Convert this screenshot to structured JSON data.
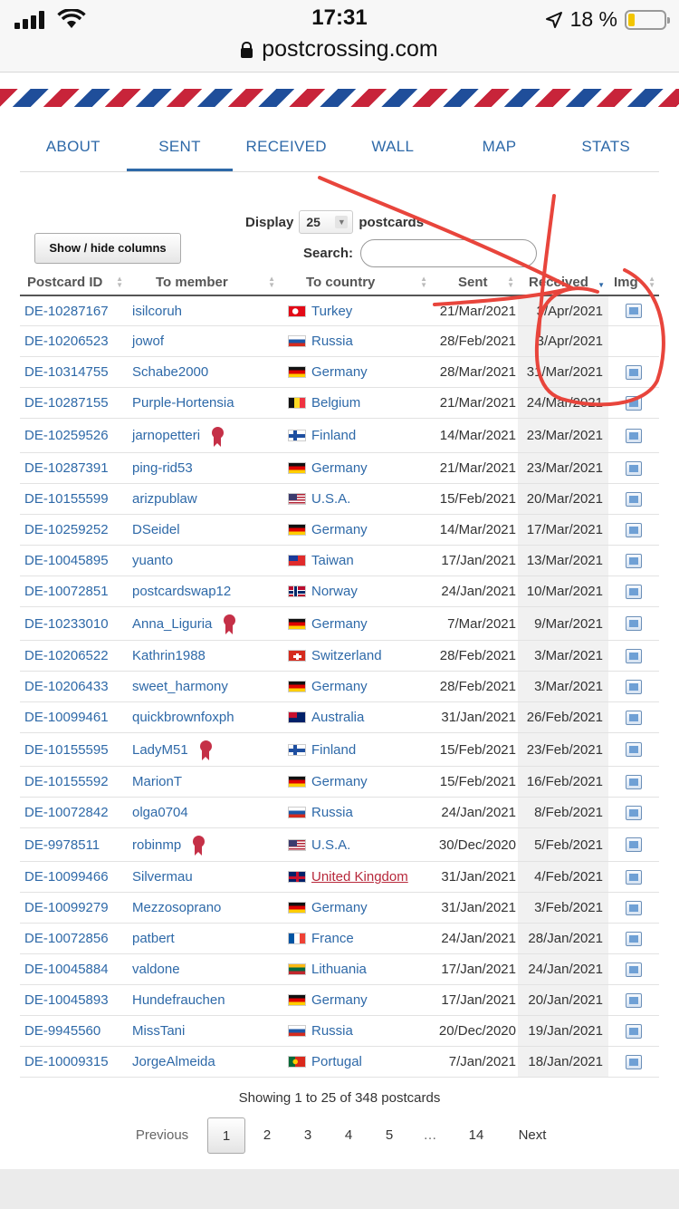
{
  "status": {
    "time": "17:31",
    "battery": "18 %",
    "battery_level": 0.18
  },
  "browser": {
    "url": "postcrossing.com"
  },
  "tabs": [
    {
      "label": "ABOUT"
    },
    {
      "label": "SENT"
    },
    {
      "label": "RECEIVED"
    },
    {
      "label": "WALL"
    },
    {
      "label": "MAP"
    },
    {
      "label": "STATS"
    }
  ],
  "active_tab": "SENT",
  "controls": {
    "show_hide": "Show / hide columns",
    "display_label": "Display",
    "display_value": "25",
    "display_suffix": "postcards",
    "search_label": "Search:",
    "search_value": ""
  },
  "table": {
    "headers": [
      "Postcard ID",
      "To member",
      "To country",
      "Sent",
      "Received",
      "Img"
    ],
    "sorted_column": "Received",
    "rows": [
      {
        "id": "DE-10287167",
        "member": "isilcoruh",
        "ribbon": false,
        "flag": "turkey",
        "country": "Turkey",
        "sent": "21/Mar/2021",
        "received": "3/Apr/2021",
        "img": true
      },
      {
        "id": "DE-10206523",
        "member": "jowof",
        "ribbon": false,
        "flag": "russia",
        "country": "Russia",
        "sent": "28/Feb/2021",
        "received": "3/Apr/2021",
        "img": false
      },
      {
        "id": "DE-10314755",
        "member": "Schabe2000",
        "ribbon": false,
        "flag": "germany",
        "country": "Germany",
        "sent": "28/Mar/2021",
        "received": "31/Mar/2021",
        "img": true
      },
      {
        "id": "DE-10287155",
        "member": "Purple-Hortensia",
        "ribbon": false,
        "flag": "belgium",
        "country": "Belgium",
        "sent": "21/Mar/2021",
        "received": "24/Mar/2021",
        "img": true
      },
      {
        "id": "DE-10259526",
        "member": "jarnopetteri",
        "ribbon": true,
        "flag": "finland",
        "country": "Finland",
        "sent": "14/Mar/2021",
        "received": "23/Mar/2021",
        "img": true
      },
      {
        "id": "DE-10287391",
        "member": "ping-rid53",
        "ribbon": false,
        "flag": "germany",
        "country": "Germany",
        "sent": "21/Mar/2021",
        "received": "23/Mar/2021",
        "img": true
      },
      {
        "id": "DE-10155599",
        "member": "arizpublaw",
        "ribbon": false,
        "flag": "usa",
        "country": "U.S.A.",
        "sent": "15/Feb/2021",
        "received": "20/Mar/2021",
        "img": true
      },
      {
        "id": "DE-10259252",
        "member": "DSeidel",
        "ribbon": false,
        "flag": "germany",
        "country": "Germany",
        "sent": "14/Mar/2021",
        "received": "17/Mar/2021",
        "img": true
      },
      {
        "id": "DE-10045895",
        "member": "yuanto",
        "ribbon": false,
        "flag": "taiwan",
        "country": "Taiwan",
        "sent": "17/Jan/2021",
        "received": "13/Mar/2021",
        "img": true
      },
      {
        "id": "DE-10072851",
        "member": "postcardswap12",
        "ribbon": false,
        "flag": "norway",
        "country": "Norway",
        "sent": "24/Jan/2021",
        "received": "10/Mar/2021",
        "img": true
      },
      {
        "id": "DE-10233010",
        "member": "Anna_Liguria",
        "ribbon": true,
        "flag": "germany",
        "country": "Germany",
        "sent": "7/Mar/2021",
        "received": "9/Mar/2021",
        "img": true
      },
      {
        "id": "DE-10206522",
        "member": "Kathrin1988",
        "ribbon": false,
        "flag": "switzerland",
        "country": "Switzerland",
        "sent": "28/Feb/2021",
        "received": "3/Mar/2021",
        "img": true
      },
      {
        "id": "DE-10206433",
        "member": "sweet_harmony",
        "ribbon": false,
        "flag": "germany",
        "country": "Germany",
        "sent": "28/Feb/2021",
        "received": "3/Mar/2021",
        "img": true
      },
      {
        "id": "DE-10099461",
        "member": "quickbrownfoxph",
        "ribbon": false,
        "flag": "australia",
        "country": "Australia",
        "sent": "31/Jan/2021",
        "received": "26/Feb/2021",
        "img": true
      },
      {
        "id": "DE-10155595",
        "member": "LadyM51",
        "ribbon": true,
        "flag": "finland",
        "country": "Finland",
        "sent": "15/Feb/2021",
        "received": "23/Feb/2021",
        "img": true
      },
      {
        "id": "DE-10155592",
        "member": "MarionT",
        "ribbon": false,
        "flag": "germany",
        "country": "Germany",
        "sent": "15/Feb/2021",
        "received": "16/Feb/2021",
        "img": true
      },
      {
        "id": "DE-10072842",
        "member": "olga0704",
        "ribbon": false,
        "flag": "russia",
        "country": "Russia",
        "sent": "24/Jan/2021",
        "received": "8/Feb/2021",
        "img": true
      },
      {
        "id": "DE-9978511",
        "member": "robinmp",
        "ribbon": true,
        "flag": "usa",
        "country": "U.S.A.",
        "sent": "30/Dec/2020",
        "received": "5/Feb/2021",
        "img": true
      },
      {
        "id": "DE-10099466",
        "member": "Silvermau",
        "ribbon": false,
        "flag": "uk",
        "country": "United Kingdom",
        "country_visited": true,
        "sent": "31/Jan/2021",
        "received": "4/Feb/2021",
        "img": true
      },
      {
        "id": "DE-10099279",
        "member": "Mezzosoprano",
        "ribbon": false,
        "flag": "germany",
        "country": "Germany",
        "sent": "31/Jan/2021",
        "received": "3/Feb/2021",
        "img": true
      },
      {
        "id": "DE-10072856",
        "member": "patbert",
        "ribbon": false,
        "flag": "france",
        "country": "France",
        "sent": "24/Jan/2021",
        "received": "28/Jan/2021",
        "img": true
      },
      {
        "id": "DE-10045884",
        "member": "valdone",
        "ribbon": false,
        "flag": "lithuania",
        "country": "Lithuania",
        "sent": "17/Jan/2021",
        "received": "24/Jan/2021",
        "img": true
      },
      {
        "id": "DE-10045893",
        "member": "Hundefrauchen",
        "ribbon": false,
        "flag": "germany",
        "country": "Germany",
        "sent": "17/Jan/2021",
        "received": "20/Jan/2021",
        "img": true
      },
      {
        "id": "DE-9945560",
        "member": "MissTani",
        "ribbon": false,
        "flag": "russia",
        "country": "Russia",
        "sent": "20/Dec/2020",
        "received": "19/Jan/2021",
        "img": true
      },
      {
        "id": "DE-10009315",
        "member": "JorgeAlmeida",
        "ribbon": false,
        "flag": "portugal",
        "country": "Portugal",
        "sent": "7/Jan/2021",
        "received": "18/Jan/2021",
        "img": true
      }
    ]
  },
  "pagination": {
    "info": "Showing 1 to 25 of 348 postcards",
    "previous": "Previous",
    "pages": [
      "1",
      "2",
      "3",
      "4",
      "5",
      "…",
      "14"
    ],
    "current": "1",
    "next": "Next"
  },
  "colors": {
    "link": "#2e69a8",
    "visited_link": "#b7283b",
    "annotation": "#e8453c",
    "airmail_red": "#c8243a",
    "airmail_blue": "#1f4e9a"
  }
}
